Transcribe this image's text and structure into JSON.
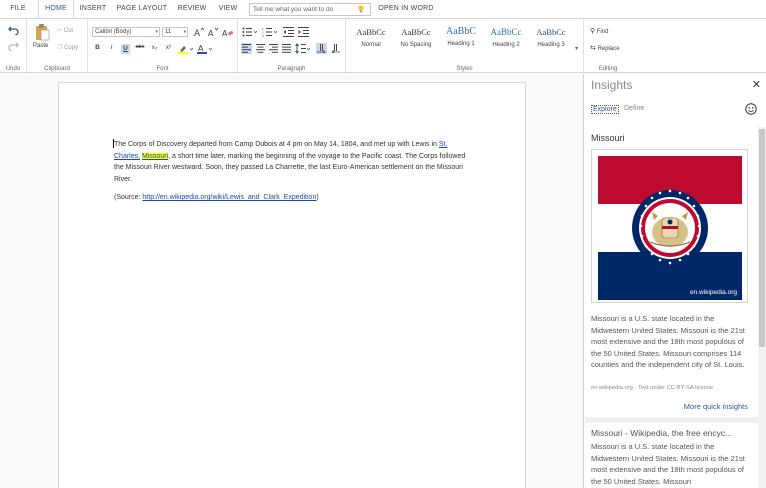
{
  "tabs": {
    "file": "FILE",
    "home": "HOME",
    "insert": "INSERT",
    "page_layout": "PAGE LAYOUT",
    "review": "REVIEW",
    "view": "VIEW",
    "open_in_word": "OPEN IN WORD"
  },
  "tellme": {
    "placeholder": "Tell me what you want to do"
  },
  "ribbon": {
    "undo_label": "Undo",
    "clipboard": {
      "paste": "Paste",
      "cut": "Cut",
      "copy": "Copy",
      "label": "Clipboard"
    },
    "font": {
      "family": "Calibri (Body)",
      "size": "11",
      "bold": "B",
      "italic": "I",
      "underline": "U",
      "strikethrough": "abc",
      "subscript": "x₂",
      "superscript": "x²",
      "label": "Font"
    },
    "paragraph": {
      "label": "Paragraph"
    },
    "styles": {
      "items": [
        {
          "sample": "AaBbCc",
          "name": "Normal"
        },
        {
          "sample": "AaBbCc",
          "name": "No Spacing"
        },
        {
          "sample": "AaBbC",
          "name": "Heading 1"
        },
        {
          "sample": "AaBbCc",
          "name": "Heading 2"
        },
        {
          "sample": "AaBbCc",
          "name": "Heading 3"
        }
      ],
      "label": "Styles"
    },
    "editing": {
      "find": "Find",
      "replace": "Replace",
      "label": "Editing"
    }
  },
  "document": {
    "p1_before": "The Corps of Discovery departed from Camp Dubois at 4 pm on May 14, 1804, and met up with Lewis in ",
    "link_stcharles": "St. Charles,",
    "link_missouri": "Missouri",
    "p1_after": ", a short time later, marking the beginning of the voyage to the Pacific coast. The Corps followed the Missouri River westward. Soon, they passed La Charrette, the last Euro-American settlement on the Missouri River.",
    "source_prefix": "(Source: ",
    "source_url": "http://en.wikipedia.org/wiki/Lewis_and_Clark_Expedition",
    "source_suffix": ")"
  },
  "insights": {
    "title": "Insights",
    "tab_explore": "Explore",
    "tab_define": "Define",
    "heading": "Missouri",
    "image_source": "en.wikipedia.org",
    "description": "Missouri is a U.S. state located in the Midwestern United States. Missouri is the 21st most extensive and the 18th most populous of the 50 United States. Missouri comprises 114 counties and the independent city of St. Louis.",
    "license": "en.wikipedia.org · Text under CC-BY-SA license",
    "more": "More quick insights",
    "result2_title": "Missouri - Wikipedia, the free encyc...",
    "result2_desc": "Missouri is a U.S. state located in the Midwestern United States. Missouri is the 21st most extensive and the 18th most populous of the 50 United States. Missouri"
  },
  "colors": {
    "accent": "#2b579a",
    "flag_red": "#bf0a30",
    "flag_blue": "#002868",
    "highlight": "#ffff00",
    "link": "#1a4ba8"
  }
}
